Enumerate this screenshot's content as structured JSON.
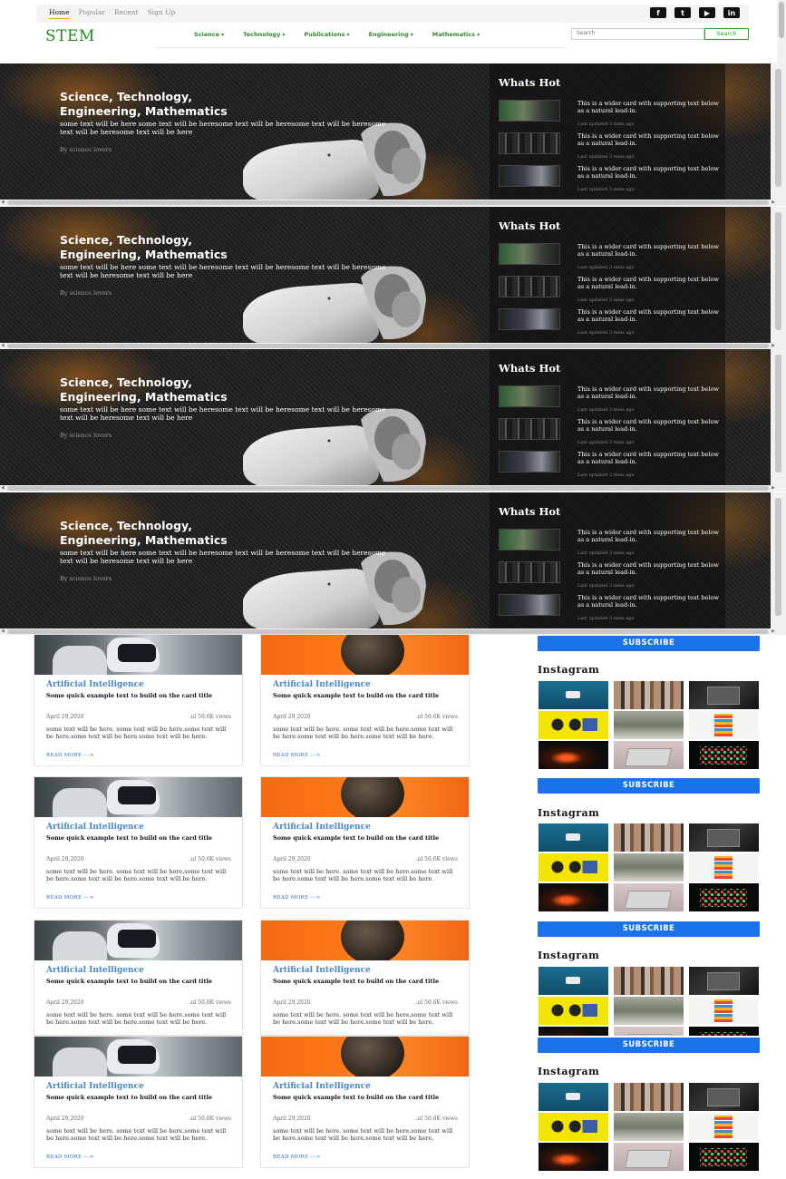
{
  "topnav": [
    "Home",
    "Popular",
    "Recent",
    "Sign Up"
  ],
  "social": [
    "facebook-icon",
    "twitter-icon",
    "youtube-icon",
    "linkedin-icon"
  ],
  "social_glyphs": {
    "facebook-icon": "f",
    "twitter-icon": "t",
    "youtube-icon": "▶",
    "linkedin-icon": "in"
  },
  "brand": "STEM",
  "mainnav": [
    "Science",
    "Technology",
    "Publications",
    "Engineering",
    "Mathematics"
  ],
  "search": {
    "placeholder": "Search",
    "button": "Search"
  },
  "hero": {
    "title_line1": "Science, Technology,",
    "title_line2": "Engineering, Mathematics",
    "text": "some text will be here some text will be heresome text will be heresome text will be heresome text will be heresome text will be here",
    "by": "By science lovers",
    "hot_title": "Whats Hot",
    "hot_items": [
      {
        "text": "This is a wider card with supporting text below as a natural lead-in.",
        "date": "Last updated 3 mins ago"
      },
      {
        "text": "This is a wider card with supporting text below as a natural lead-in.",
        "date": "Last updated 3 mins ago"
      },
      {
        "text": "This is a wider card with supporting text below as a natural lead-in.",
        "date": "Last updated 3 mins ago"
      }
    ]
  },
  "card": {
    "title": "Artificial Intelligence",
    "subtitle": "Some quick example text to build on the card title",
    "date": "April 29,2020",
    "views": ".ııl 50.6K views",
    "body": "some text will be here. some text will be here.some text will be here.some text will be here.some text will be here.",
    "read_more": "READ MORE   --->"
  },
  "sidebar": {
    "subscribe": "SUBSCRIBE",
    "instagram": "Instagram"
  }
}
